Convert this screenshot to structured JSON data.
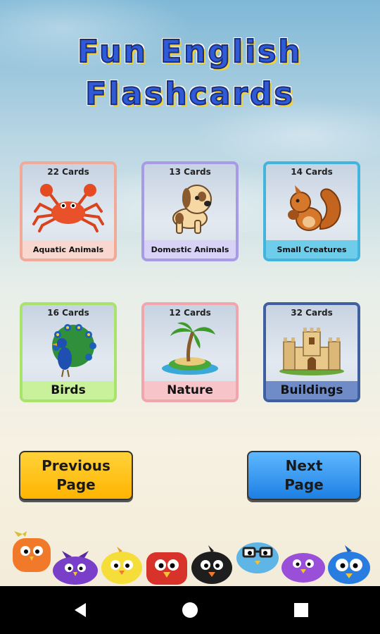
{
  "title": {
    "line1": "Fun English",
    "line2": "Flashcards"
  },
  "cards": [
    {
      "count": "22 Cards",
      "label": "Aquatic Animals",
      "icon": "crab-icon"
    },
    {
      "count": "13 Cards",
      "label": "Domestic Animals",
      "icon": "puppy-icon"
    },
    {
      "count": "14 Cards",
      "label": "Small Creatures",
      "icon": "squirrel-icon"
    },
    {
      "count": "16 Cards",
      "label": "Birds",
      "icon": "peacock-icon"
    },
    {
      "count": "12 Cards",
      "label": "Nature",
      "icon": "palm-island-icon"
    },
    {
      "count": "32 Cards",
      "label": "Buildings",
      "icon": "castle-icon"
    }
  ],
  "buttons": {
    "previous_line1": "Previous",
    "previous_line2": "Page",
    "next_line1": "Next",
    "next_line2": "Page"
  },
  "decor_birds": [
    "orange-bird-icon",
    "purple-bird-icon",
    "yellow-bird-icon",
    "red-bird-icon",
    "black-bird-icon",
    "blue-bird-glasses-icon",
    "purple-bird-icon",
    "blue-bird-icon"
  ],
  "system_nav": {
    "back": "back-icon",
    "home": "home-icon",
    "recents": "recents-icon"
  },
  "colors": {
    "title_blue": "#2f5bd8",
    "prev_button": "#ffc21a",
    "next_button": "#3a9bf0"
  }
}
